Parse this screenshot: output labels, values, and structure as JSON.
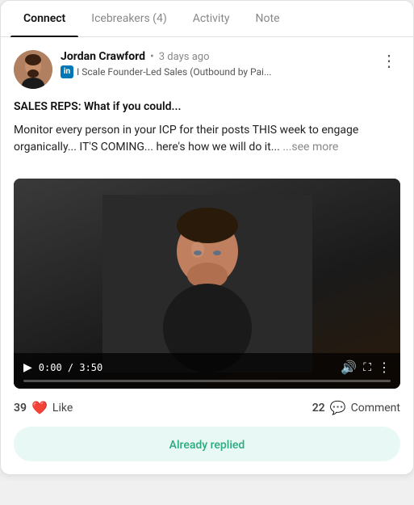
{
  "tabs": [
    {
      "id": "connect",
      "label": "Connect",
      "active": true
    },
    {
      "id": "icebreakers",
      "label": "Icebreakers (4)",
      "active": false
    },
    {
      "id": "activity",
      "label": "Activity",
      "active": false
    },
    {
      "id": "note",
      "label": "Note",
      "active": false
    }
  ],
  "post": {
    "author": {
      "name": "Jordan Crawford",
      "time": "3 days ago",
      "subtitle": "I Scale Founder-Led Sales (Outbound by Pai..."
    },
    "text_line1": "SALES REPS: What if you could...",
    "text_line2": "Monitor every person in your ICP for their posts THIS week to engage organically... IT'S COMING... here's how we will do it...",
    "see_more": "...see more",
    "video": {
      "time_current": "0:00",
      "time_total": "3:50",
      "time_display": "0:00 / 3:50"
    },
    "reactions": {
      "likes_count": "39",
      "likes_label": "Like",
      "comments_count": "22",
      "comments_label": "Comment"
    },
    "already_replied_label": "Already replied"
  },
  "icons": {
    "more_dots": "⋮",
    "play": "▶",
    "volume": "🔊",
    "fullscreen": "⛶",
    "more_video": "⋮",
    "heart": "❤️",
    "comment_bubble": "💬"
  }
}
